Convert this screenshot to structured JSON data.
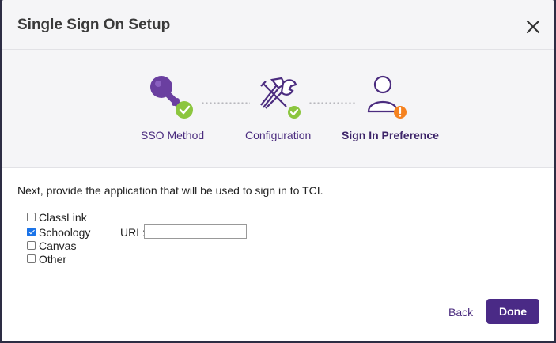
{
  "dialog": {
    "title": "Single Sign On Setup",
    "close_icon": "close-icon"
  },
  "steps": [
    {
      "label": "SSO Method",
      "icon": "key-icon",
      "status": "complete"
    },
    {
      "label": "Configuration",
      "icon": "tools-icon",
      "status": "complete"
    },
    {
      "label": "Sign In Preference",
      "icon": "user-icon",
      "status": "warning"
    }
  ],
  "colors": {
    "brand_purple": "#4a2a86",
    "complete_green": "#8cc63f",
    "warning_orange": "#f58220"
  },
  "form": {
    "instruction": "Next, provide the application that will be used to sign in to TCI.",
    "options": [
      {
        "label": "ClassLink",
        "checked": false
      },
      {
        "label": "Schoology",
        "checked": true
      },
      {
        "label": "Canvas",
        "checked": false
      },
      {
        "label": "Other",
        "checked": false
      }
    ],
    "url_label": "URL:",
    "url_value": ""
  },
  "footer": {
    "back_label": "Back",
    "done_label": "Done"
  }
}
